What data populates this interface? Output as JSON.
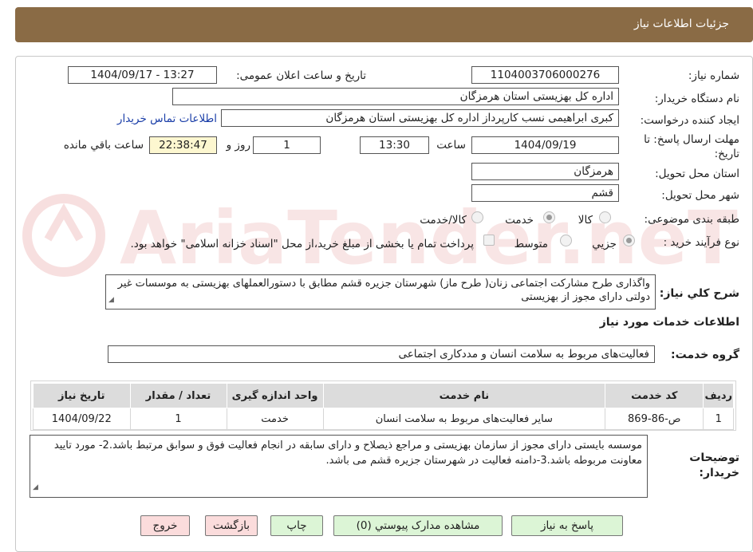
{
  "header": {
    "title": "جزئیات اطلاعات نیاز"
  },
  "fields": {
    "need_number_label": "شماره نیاز:",
    "need_number": "1104003706000276",
    "announce_label": "تاریخ و ساعت اعلان عمومی:",
    "announce_value": "1404/09/17 - 13:27",
    "buyer_org_label": "نام دستگاه خریدار:",
    "buyer_org": "اداره کل بهزیستی استان هرمزگان",
    "requester_label": "ایجاد کننده درخواست:",
    "requester": "کبری  ابراهیمی نسب کارپرداز اداره کل بهزیستی استان هرمزگان",
    "contact_link": "اطلاعات تماس خریدار",
    "deadline_label": "مهلت ارسال پاسخ: تا تاریخ:",
    "deadline_date": "1404/09/19",
    "time_label": "ساعت",
    "deadline_time": "13:30",
    "days_value": "1",
    "days_label": "روز و",
    "remaining_time": "22:38:47",
    "remaining_label": "ساعت باقي مانده",
    "province_label": "استان محل تحویل:",
    "province": "هرمزگان",
    "city_label": "شهر محل تحویل:",
    "city": "قشم",
    "category_label": "طبقه بندی موضوعی:",
    "category_options": [
      "کالا",
      "خدمت",
      "کالا/خدمت"
    ],
    "process_label": "نوع فرآیند خرید :",
    "process_options": [
      "جزيي",
      "متوسط"
    ],
    "payment_note": "پرداخت تمام یا بخشی از مبلغ خرید،از محل \"اسناد خزانه اسلامی\" خواهد بود.",
    "description_label": "شرح کلي نیاز:",
    "description": "واگذاری طرح مشارکت اجتماعی زنان( طرح ماز) شهرستان جزیره قشم مطابق با دستورالعملهای بهزیستی به موسسات غیر دولتی دارای مجوز از بهزیستی"
  },
  "services": {
    "section_title": "اطلاعات خدمات مورد نیاز",
    "group_label": "گروه خدمت:",
    "group_value": "فعالیت‌های مربوط به سلامت انسان و مددکاری اجتماعی",
    "columns": [
      "ردیف",
      "کد خدمت",
      "نام خدمت",
      "واحد اندازه گیری",
      "تعداد / مقدار",
      "تاریخ نیاز"
    ],
    "rows": [
      [
        "1",
        "ص-86-869",
        "سایر فعالیت‌های مربوط به سلامت انسان",
        "خدمت",
        "1",
        "1404/09/22"
      ]
    ]
  },
  "buyer_notes": {
    "label": "توضیحات خریدار:",
    "text": "موسسه بایستی دارای مجوز از سازمان بهزیستی و مراجع ذیصلاح  و  دارای سابقه در انجام فعالیت فوق  و سوابق مرتبط باشد.2- مورد تایید معاونت مربوطه باشد.3-دامنه فعالیت در شهرستان جزیره قشم می باشد."
  },
  "buttons": {
    "reply": "پاسخ به نیاز",
    "attachments": "مشاهده مدارک پیوستي (0)",
    "print": "چاپ",
    "back": "بازگشت",
    "exit": "خروج"
  },
  "watermark_text": "AriaTender.neT",
  "colors": {
    "header": "#8a6b45",
    "watermark": "#f5d5d5",
    "link": "#1a3ea8",
    "green_button": "#dcf5d6",
    "pink_button": "#fbdcdc"
  }
}
